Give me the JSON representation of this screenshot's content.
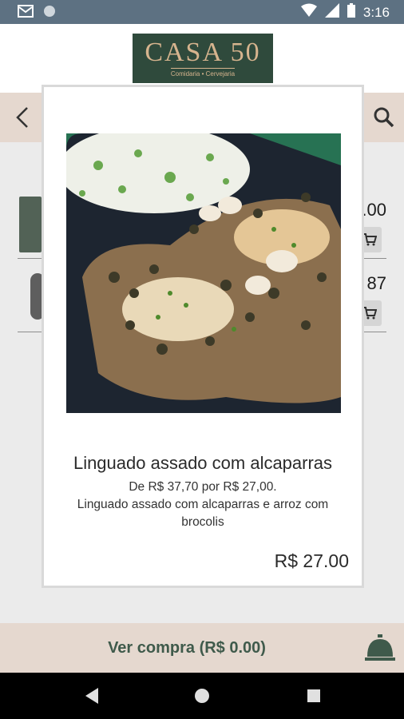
{
  "status_bar": {
    "time": "3:16",
    "icons": [
      "gmail-icon",
      "circle-icon",
      "wifi-icon",
      "signal-icon",
      "battery-icon"
    ]
  },
  "header": {
    "logo_title": "CASA 50",
    "logo_subtitle": "Comidaria • Cervejaria"
  },
  "nav": {
    "back_icon": "chevron-left-icon",
    "search_icon": "search-icon"
  },
  "background_list": {
    "items": [
      {
        "price_fragment": ".00"
      },
      {
        "price_fragment": "87"
      }
    ]
  },
  "modal": {
    "title": "Linguado assado com alcaparras",
    "description_line1": "De R$ 37,70 por R$ 27,00.",
    "description_line2": "Linguado assado com alcaparras e arroz com brocolis",
    "price": "R$ 27.00"
  },
  "bottom_bar": {
    "checkout_label": "Ver compra (R$ 0.00)",
    "bell_icon": "service-bell-icon"
  },
  "android_nav": {
    "icons": [
      "back-triangle-icon",
      "home-circle-icon",
      "recents-square-icon"
    ]
  },
  "colors": {
    "status_bar": "#5d7182",
    "nav_bar": "#e5d8cf",
    "brand_green": "#2f4a3c",
    "brand_gold": "#d6b48e",
    "checkout_text": "#3f5a4b"
  }
}
